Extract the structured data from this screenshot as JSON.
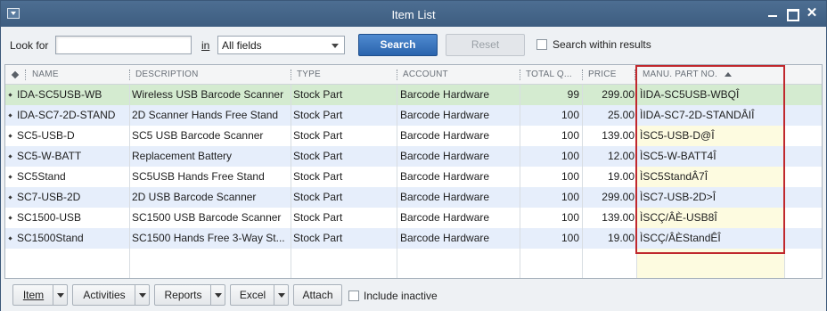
{
  "window": {
    "title": "Item List"
  },
  "toolbar": {
    "look_for_label": "Look for",
    "look_for_value": "",
    "in_label": "in",
    "field_select": "All fields",
    "search_label": "Search",
    "reset_label": "Reset",
    "within_results_label": "Search within results"
  },
  "table": {
    "columns": [
      "NAME",
      "DESCRIPTION",
      "TYPE",
      "ACCOUNT",
      "TOTAL Q...",
      "PRICE",
      "MANU. PART NO."
    ],
    "rows": [
      {
        "name": "IDA-SC5USB-WB",
        "description": "Wireless USB Barcode Scanner",
        "type": "Stock Part",
        "account": "Barcode Hardware",
        "qty": "99",
        "price": "299.00",
        "part_no": "ÌIDA-SC5USB-WBQÎ"
      },
      {
        "name": "IDA-SC7-2D-STAND",
        "description": "2D Scanner Hands Free Stand",
        "type": "Stock Part",
        "account": "Barcode Hardware",
        "qty": "100",
        "price": "25.00",
        "part_no": "ÌIDA-SC7-2D-STANDÂIÎ"
      },
      {
        "name": "SC5-USB-D",
        "description": "SC5 USB Barcode Scanner",
        "type": "Stock Part",
        "account": "Barcode Hardware",
        "qty": "100",
        "price": "139.00",
        "part_no": "ÌSC5-USB-D@Î"
      },
      {
        "name": "SC5-W-BATT",
        "description": "Replacement Battery",
        "type": "Stock Part",
        "account": "Barcode Hardware",
        "qty": "100",
        "price": "12.00",
        "part_no": "ÌSC5-W-BATT4Î"
      },
      {
        "name": "SC5Stand",
        "description": "SC5USB Hands Free Stand",
        "type": "Stock Part",
        "account": "Barcode Hardware",
        "qty": "100",
        "price": "19.00",
        "part_no": "ÌSC5StandÂ7Î"
      },
      {
        "name": "SC7-USB-2D",
        "description": "2D USB Barcode Scanner",
        "type": "Stock Part",
        "account": "Barcode Hardware",
        "qty": "100",
        "price": "299.00",
        "part_no": "ÌSC7-USB-2D>Î"
      },
      {
        "name": "SC1500-USB",
        "description": "SC1500 USB Barcode Scanner",
        "type": "Stock Part",
        "account": "Barcode Hardware",
        "qty": "100",
        "price": "139.00",
        "part_no": "ÌSCÇ/ÂÈ-USB8Î"
      },
      {
        "name": "SC1500Stand",
        "description": "SC1500 Hands Free 3-Way St...",
        "type": "Stock Part",
        "account": "Barcode Hardware",
        "qty": "100",
        "price": "19.00",
        "part_no": "ÌSCÇ/ÂÈStandÊÎ"
      }
    ]
  },
  "bottom": {
    "item_label": "Item",
    "activities_label": "Activities",
    "reports_label": "Reports",
    "excel_label": "Excel",
    "attach_label": "Attach",
    "include_inactive_label": "Include inactive"
  },
  "colors": {
    "title_bar": "#3d5d80",
    "search_button": "#2a64ad",
    "selected_row": "#d4ebd0",
    "alt_row": "#e6eefb",
    "highlight_box": "#c0282d"
  }
}
